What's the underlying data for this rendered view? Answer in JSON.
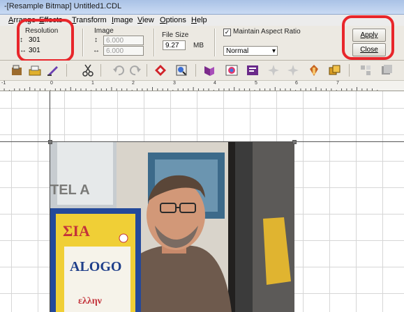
{
  "window": {
    "title": "-[Resample Bitmap] Untitled1.CDL"
  },
  "menu": {
    "items": [
      "Arrange",
      "Effects",
      "Transform",
      "Image",
      "View",
      "Options",
      "Help"
    ]
  },
  "propbar": {
    "resolution_label": "Resolution",
    "res_h": "301",
    "res_v": "301",
    "image_label": "Image",
    "image_h": "6.000",
    "image_w": "6.000",
    "filesize_label": "File Size",
    "filesize_value": "9.27",
    "filesize_unit": "MB",
    "aspect_label": "Maintain Aspect Ratio",
    "aspect_checked": true,
    "mode_value": "Normal",
    "apply_label": "Apply",
    "close_label": "Close"
  },
  "toolbar": {
    "icons": [
      "open-icon",
      "scanner-icon",
      "brush-icon",
      "cut-icon",
      "undo-icon",
      "redo-icon",
      "erase-icon",
      "zoom-icon",
      "layer-icon",
      "color-icon",
      "text-icon",
      "sparkle-icon",
      "sparkle2-icon",
      "mask-icon",
      "stack-icon",
      "tool1-icon",
      "tool2-icon"
    ]
  },
  "ruler": {
    "labels": [
      "0",
      "1",
      "2",
      "3",
      "4",
      "5",
      "6",
      "7"
    ],
    "leading": "-1"
  },
  "colors": {
    "highlight": "#e8262b",
    "titlebar": "#a9c2e6"
  }
}
